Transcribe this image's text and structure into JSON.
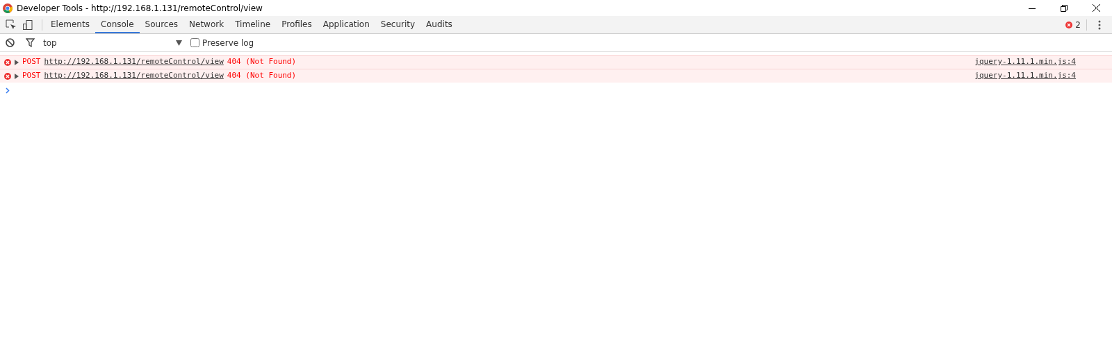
{
  "window": {
    "title": "Developer Tools - http://192.168.1.131/remoteControl/view"
  },
  "tabs": [
    {
      "label": "Elements",
      "selected": false
    },
    {
      "label": "Console",
      "selected": true
    },
    {
      "label": "Sources",
      "selected": false
    },
    {
      "label": "Network",
      "selected": false
    },
    {
      "label": "Timeline",
      "selected": false
    },
    {
      "label": "Profiles",
      "selected": false
    },
    {
      "label": "Application",
      "selected": false
    },
    {
      "label": "Security",
      "selected": false
    },
    {
      "label": "Audits",
      "selected": false
    }
  ],
  "error_count": "2",
  "filter_bar": {
    "context": "top",
    "preserve_log": {
      "label": "Preserve log",
      "checked": false
    }
  },
  "messages": [
    {
      "method": "POST",
      "url": "http://192.168.1.131/remoteControl/view",
      "status": "404 (Not Found)",
      "source": "jquery-1.11.1.min.js:4"
    },
    {
      "method": "POST",
      "url": "http://192.168.1.131/remoteControl/view",
      "status": "404 (Not Found)",
      "source": "jquery-1.11.1.min.js:4"
    }
  ]
}
